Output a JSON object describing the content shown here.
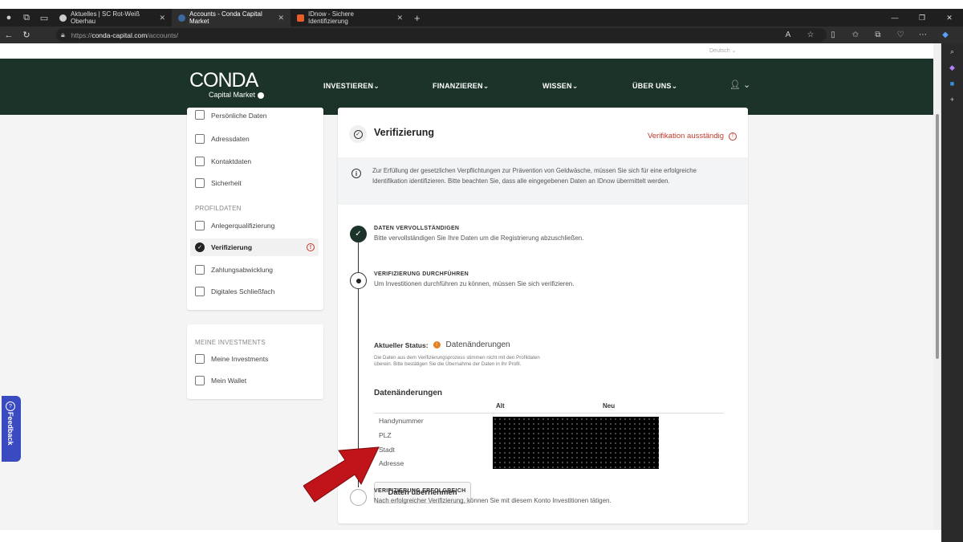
{
  "browser": {
    "tabs": [
      {
        "label": "Aktuelles | SC Rot-Weiß Oberhau",
        "favicon_color": "#cccccc",
        "active": false
      },
      {
        "label": "Accounts - Conda Capital Market",
        "favicon_color": "#3b6aa0",
        "active": true
      },
      {
        "label": "IDnow - Sichere Identifizierung",
        "favicon_color": "#e85c2a",
        "active": false
      }
    ],
    "url_prefix": "https://",
    "url_host": "conda-capital.com",
    "url_path": "/accounts/"
  },
  "site": {
    "language": "Deutsch",
    "logo_big": "CONDA",
    "logo_small": "Capital Market",
    "menu": [
      "INVESTIEREN",
      "FINANZIEREN",
      "WISSEN",
      "ÜBER UNS"
    ]
  },
  "sidebar": {
    "account_items": [
      "Persönliche Daten",
      "Adressdaten",
      "Kontaktdaten",
      "Sicherheit"
    ],
    "profile_heading": "PROFILDATEN",
    "profile_items": [
      "Anlegerqualifizierung",
      "Verifizierung",
      "Zahlungsabwicklung",
      "Digitales Schließfach"
    ],
    "investments_heading": "MEINE INVESTMENTS",
    "investment_items": [
      "Meine Investments",
      "Mein Wallet"
    ]
  },
  "main": {
    "title": "Verifizierung",
    "status": "Verifikation ausständig",
    "info": "Zur Erfüllung der gesetzlichen Verpflichtungen zur Prävention von Geldwäsche, müssen Sie sich für eine erfolgreiche Identifikation identifizieren. Bitte beachten Sie, dass alle eingegebenen Daten an IDnow übermittelt werden.",
    "steps": [
      {
        "title": "DATEN VERVOLLSTÄNDIGEN",
        "desc": "Bitte vervollständigen Sie Ihre Daten um die Registrierung abzuschließen."
      },
      {
        "title": "VERIFIZIERUNG DURCHFÜHREN",
        "desc": "Um Investitionen durchführen zu können, müssen Sie sich verifizieren."
      },
      {
        "title": "VERIFIZIERUNG ERFOLGREICH",
        "desc": "Nach erfolgreicher Verifizierung, können Sie mit diesem Konto Investitionen tätigen."
      }
    ],
    "current_status_label": "Aktueller Status:",
    "current_status_value": "Datenänderungen",
    "status_note": "Die Daten aus dem Verifizierungsprozess stimmen nicht mit den Profildaten überein. Bitte bestätigen Sie die Übernahme der Daten in Ihr Profil.",
    "changes_title": "Datenänderungen",
    "col_old": "Alt",
    "col_new": "Neu",
    "rows": [
      "Handynummer",
      "PLZ",
      "Stadt",
      "Adresse"
    ],
    "button": "Daten übernehmen"
  },
  "feedback": "Feedback"
}
